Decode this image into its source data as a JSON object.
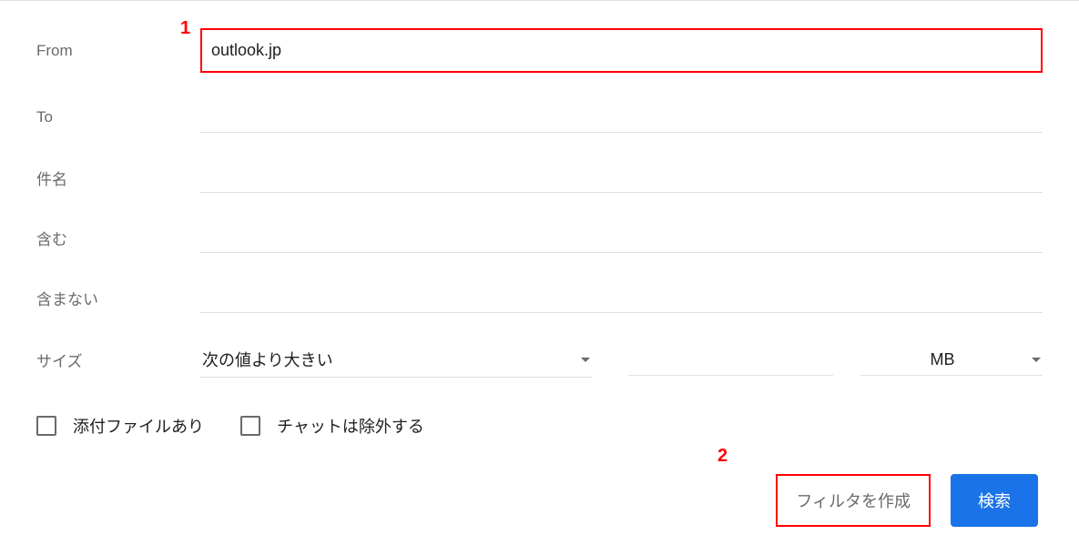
{
  "annotations": {
    "num1": "1",
    "num2": "2"
  },
  "form": {
    "from": {
      "label": "From",
      "value": "outlook.jp"
    },
    "to": {
      "label": "To",
      "value": ""
    },
    "subject": {
      "label": "件名",
      "value": ""
    },
    "includes": {
      "label": "含む",
      "value": ""
    },
    "excludes": {
      "label": "含まない",
      "value": ""
    },
    "size": {
      "label": "サイズ",
      "operator": "次の値より大きい",
      "value": "",
      "unit": "MB"
    },
    "checkboxes": {
      "has_attachment": "添付ファイルあり",
      "exclude_chat": "チャットは除外する"
    }
  },
  "buttons": {
    "create_filter": "フィルタを作成",
    "search": "検索"
  }
}
